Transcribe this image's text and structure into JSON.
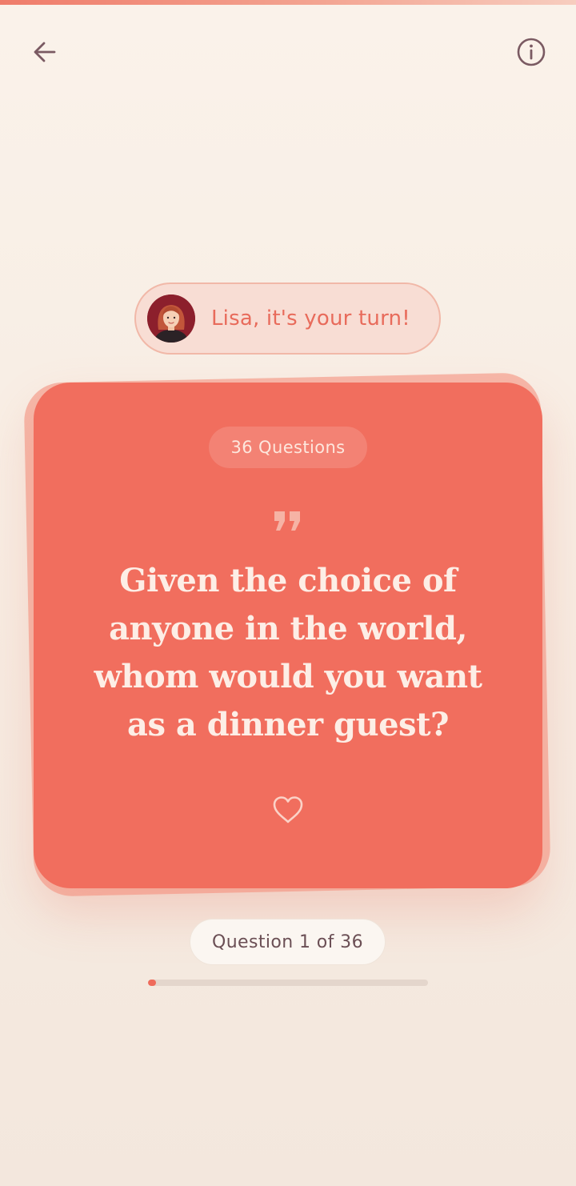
{
  "header": {
    "back_icon": "arrow-left-icon",
    "info_icon": "info-circle-icon"
  },
  "turn_indicator": {
    "avatar_icon": "player-avatar",
    "text": "Lisa, it's your turn!"
  },
  "card": {
    "deck_label": "36 Questions",
    "quote_icon": "quote-icon",
    "question": "Given the choice of anyone in the world, whom would you want as a dinner guest?",
    "favorite_icon": "heart-outline-icon"
  },
  "progress": {
    "label": "Question 1 of 36",
    "current": 1,
    "total": 36
  },
  "colors": {
    "accent": "#f16e5e",
    "card_back": "#f6b7a8",
    "turn_text": "#e86b5b",
    "icon": "#7a5a62"
  }
}
